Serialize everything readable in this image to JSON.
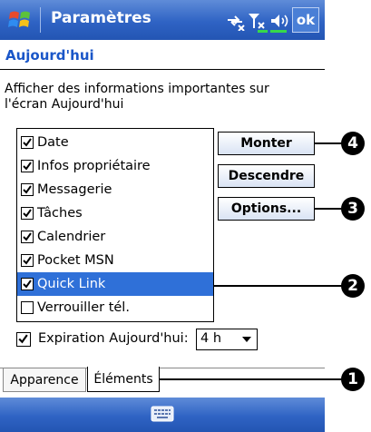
{
  "titlebar": {
    "title": "Paramètres",
    "ok_label": "ok"
  },
  "header": {
    "title": "Aujourd'hui"
  },
  "description": "Afficher des informations importantes sur l'écran Aujourd'hui",
  "items": [
    {
      "label": "Date",
      "checked": true,
      "selected": false
    },
    {
      "label": "Infos propriétaire",
      "checked": true,
      "selected": false
    },
    {
      "label": "Messagerie",
      "checked": true,
      "selected": false
    },
    {
      "label": "Tâches",
      "checked": true,
      "selected": false
    },
    {
      "label": "Calendrier",
      "checked": true,
      "selected": false
    },
    {
      "label": "Pocket MSN",
      "checked": true,
      "selected": false
    },
    {
      "label": "Quick Link",
      "checked": true,
      "selected": true
    },
    {
      "label": "Verrouiller tél.",
      "checked": false,
      "selected": false
    }
  ],
  "buttons": {
    "up": "Monter",
    "down": "Descendre",
    "options": "Options..."
  },
  "expiration": {
    "label": "Expiration Aujourd'hui:",
    "checked": true,
    "value": "4 h"
  },
  "tabs": {
    "appearance": "Apparence",
    "items": "Éléments"
  },
  "callouts": {
    "c1": "1",
    "c2": "2",
    "c3": "3",
    "c4": "4"
  },
  "colors": {
    "accent": "#2f63c4",
    "title": "#1a56c8",
    "selection": "#2f70d8"
  }
}
